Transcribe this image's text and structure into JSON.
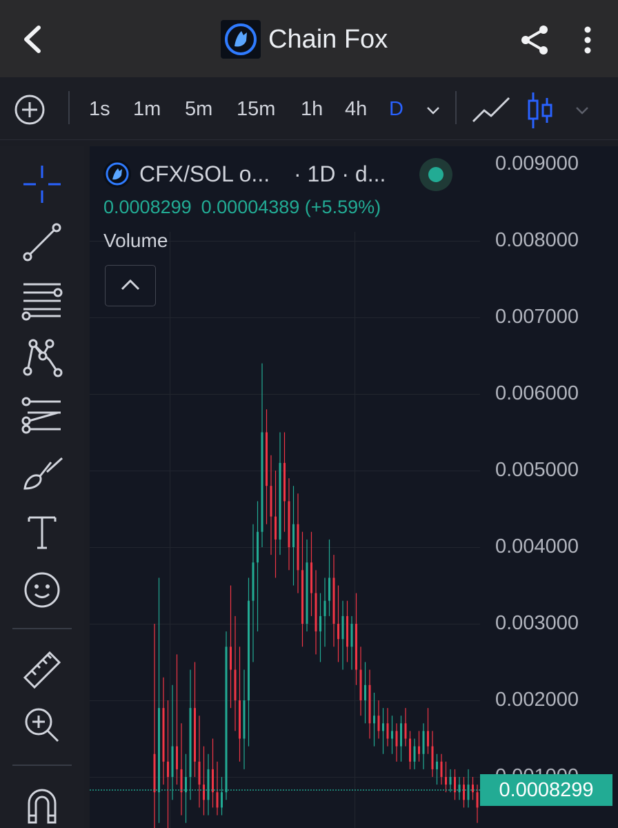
{
  "header": {
    "title": "Chain Fox"
  },
  "toolbar": {
    "timeframes": [
      "1s",
      "1m",
      "5m",
      "15m",
      "1h",
      "4h",
      "D"
    ],
    "active_timeframe": "D"
  },
  "legend": {
    "symbol": "CFX/SOL o...",
    "interval": "· 1D · d...",
    "last_price": "0.0008299",
    "change": "0.00004389 (+5.59%)",
    "indicator": "Volume"
  },
  "price_axis": {
    "ticks": [
      "0.009000",
      "0.008000",
      "0.007000",
      "0.006000",
      "0.005000",
      "0.004000",
      "0.003000",
      "0.002000",
      "0.001000"
    ],
    "current_price": "0.0008299"
  },
  "colors": {
    "up": "#22ab94",
    "down": "#f23645",
    "active": "#2962ff",
    "background": "#131722"
  },
  "icons": {
    "sidebar": [
      "crosshair-icon",
      "trend-line-icon",
      "horizontal-lines-icon",
      "pattern-icon",
      "forecast-icon",
      "brush-icon",
      "text-icon",
      "emoji-icon",
      "ruler-icon",
      "zoom-in-icon",
      "magnet-icon"
    ]
  },
  "chart_data": {
    "type": "candlestick",
    "x_unit": "day",
    "ylim": [
      0.0,
      0.0093
    ],
    "ohlc": [
      [
        0.0013,
        0.003,
        0.0001,
        0.0008
      ],
      [
        0.0008,
        0.0036,
        0.0004,
        0.0019
      ],
      [
        0.0019,
        0.0023,
        0.0009,
        0.0012
      ],
      [
        0.0012,
        0.002,
        0.0003,
        0.001
      ],
      [
        0.001,
        0.0022,
        0.0007,
        0.0014
      ],
      [
        0.0014,
        0.0026,
        0.0009,
        0.0011
      ],
      [
        0.0011,
        0.0017,
        0.0005,
        0.0008
      ],
      [
        0.0008,
        0.0013,
        0.0004,
        0.001
      ],
      [
        0.001,
        0.0024,
        0.0007,
        0.0019
      ],
      [
        0.0019,
        0.0025,
        0.001,
        0.0012
      ],
      [
        0.0012,
        0.0018,
        0.0006,
        0.0009
      ],
      [
        0.0009,
        0.0014,
        0.0005,
        0.0007
      ],
      [
        0.0007,
        0.0013,
        0.0005,
        0.0011
      ],
      [
        0.0011,
        0.0015,
        0.0006,
        0.0008
      ],
      [
        0.0008,
        0.0012,
        0.0005,
        0.0006
      ],
      [
        0.0006,
        0.001,
        0.0005,
        0.0008
      ],
      [
        0.0008,
        0.0029,
        0.0007,
        0.0027
      ],
      [
        0.0027,
        0.0035,
        0.0019,
        0.0024
      ],
      [
        0.0024,
        0.0031,
        0.0016,
        0.002
      ],
      [
        0.002,
        0.0027,
        0.0012,
        0.0015
      ],
      [
        0.0015,
        0.0024,
        0.0011,
        0.002
      ],
      [
        0.002,
        0.0036,
        0.0014,
        0.0033
      ],
      [
        0.0033,
        0.0043,
        0.0025,
        0.0038
      ],
      [
        0.0038,
        0.0046,
        0.0029,
        0.0042
      ],
      [
        0.0042,
        0.0064,
        0.004,
        0.0055
      ],
      [
        0.0055,
        0.0058,
        0.0043,
        0.0048
      ],
      [
        0.0048,
        0.0052,
        0.0039,
        0.0044
      ],
      [
        0.0044,
        0.005,
        0.0036,
        0.0041
      ],
      [
        0.0041,
        0.0055,
        0.0039,
        0.0051
      ],
      [
        0.0051,
        0.0055,
        0.0042,
        0.0046
      ],
      [
        0.0046,
        0.0049,
        0.0037,
        0.004
      ],
      [
        0.004,
        0.0048,
        0.0035,
        0.0043
      ],
      [
        0.0043,
        0.0047,
        0.0034,
        0.0037
      ],
      [
        0.0037,
        0.0042,
        0.0027,
        0.003
      ],
      [
        0.003,
        0.0041,
        0.0029,
        0.0038
      ],
      [
        0.0038,
        0.0042,
        0.0031,
        0.0034
      ],
      [
        0.0034,
        0.0037,
        0.0026,
        0.0029
      ],
      [
        0.0029,
        0.0034,
        0.0025,
        0.0031
      ],
      [
        0.0031,
        0.0036,
        0.0027,
        0.0033
      ],
      [
        0.0033,
        0.0041,
        0.0031,
        0.0036
      ],
      [
        0.0036,
        0.0039,
        0.0027,
        0.003
      ],
      [
        0.003,
        0.0035,
        0.0025,
        0.0028
      ],
      [
        0.0028,
        0.0033,
        0.0024,
        0.0031
      ],
      [
        0.0031,
        0.0033,
        0.0025,
        0.0027
      ],
      [
        0.0027,
        0.0031,
        0.0024,
        0.003
      ],
      [
        0.003,
        0.0034,
        0.0022,
        0.0024
      ],
      [
        0.0024,
        0.0027,
        0.0018,
        0.002
      ],
      [
        0.002,
        0.0025,
        0.0017,
        0.0022
      ],
      [
        0.0022,
        0.0024,
        0.0015,
        0.0017
      ],
      [
        0.0017,
        0.0021,
        0.0014,
        0.0018
      ],
      [
        0.0018,
        0.002,
        0.0015,
        0.0016
      ],
      [
        0.0016,
        0.0019,
        0.0013,
        0.0017
      ],
      [
        0.0017,
        0.0019,
        0.0014,
        0.0015
      ],
      [
        0.0015,
        0.0018,
        0.0013,
        0.0016
      ],
      [
        0.0016,
        0.0017,
        0.0012,
        0.0014
      ],
      [
        0.0014,
        0.0018,
        0.0012,
        0.0017
      ],
      [
        0.0017,
        0.0019,
        0.0014,
        0.0015
      ],
      [
        0.0015,
        0.0016,
        0.0011,
        0.0012
      ],
      [
        0.0012,
        0.0015,
        0.0011,
        0.0014
      ],
      [
        0.0014,
        0.0016,
        0.0012,
        0.0013
      ],
      [
        0.0013,
        0.0017,
        0.0011,
        0.0016
      ],
      [
        0.0016,
        0.0019,
        0.0013,
        0.0014
      ],
      [
        0.0014,
        0.0016,
        0.001,
        0.0011
      ],
      [
        0.0011,
        0.0013,
        0.0009,
        0.0012
      ],
      [
        0.0012,
        0.0013,
        0.0009,
        0.001
      ],
      [
        0.001,
        0.0012,
        0.0008,
        0.0009
      ],
      [
        0.0009,
        0.0011,
        0.0008,
        0.001
      ],
      [
        0.001,
        0.0011,
        0.0007,
        0.0008
      ],
      [
        0.0008,
        0.001,
        0.0007,
        0.0009
      ],
      [
        0.0009,
        0.001,
        0.0006,
        0.0007
      ],
      [
        0.0007,
        0.0011,
        0.0006,
        0.0009
      ],
      [
        0.0009,
        0.001,
        0.0007,
        0.0008
      ],
      [
        0.0008,
        0.0009,
        0.0004,
        0.0006
      ],
      [
        0.0006,
        0.0009,
        0.0005,
        0.0008303
      ]
    ]
  }
}
